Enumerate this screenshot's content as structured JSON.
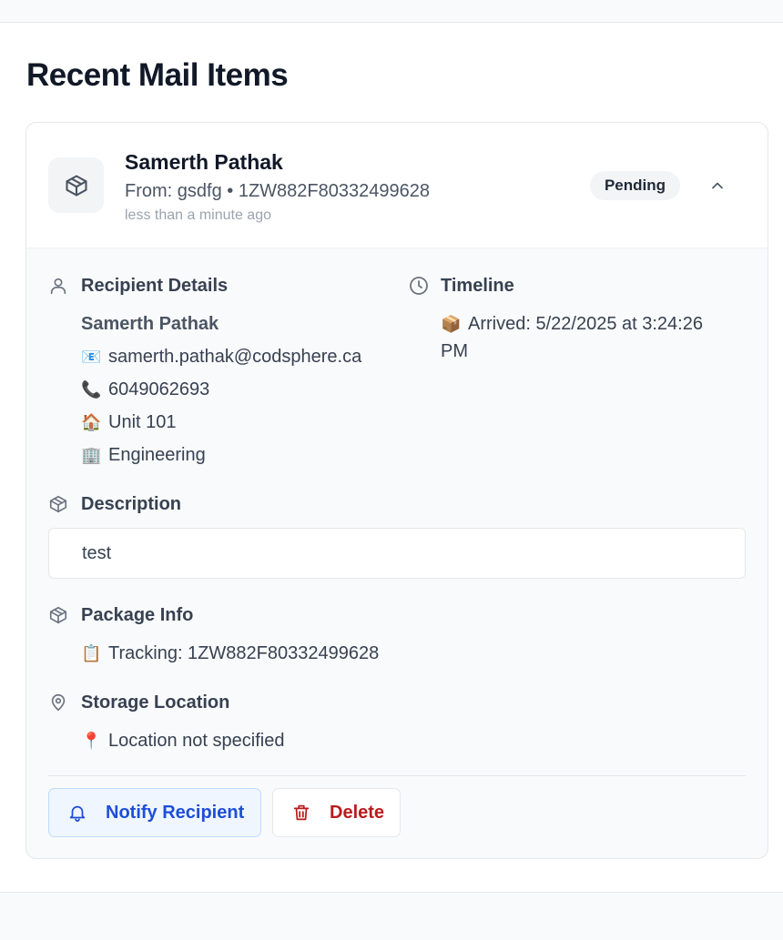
{
  "page": {
    "title": "Recent Mail Items"
  },
  "mail_item": {
    "recipient_name": "Samerth Pathak",
    "from_line": "From: gsdfg • 1ZW882F80332499628",
    "time_ago": "less than a minute ago",
    "status": "Pending",
    "recipient_details": {
      "title": "Recipient Details",
      "name": "Samerth Pathak",
      "email": "samerth.pathak@codsphere.ca",
      "phone": "6049062693",
      "unit": "Unit 101",
      "department": "Engineering",
      "email_emoji": "📧",
      "phone_emoji": "📞",
      "unit_emoji": "🏠",
      "department_emoji": "🏢"
    },
    "timeline": {
      "title": "Timeline",
      "arrived_emoji": "📦",
      "arrived_line1": "Arrived: 5/22/2025 at 3:24:26",
      "arrived_line2": "PM"
    },
    "description": {
      "title": "Description",
      "text": "test"
    },
    "package_info": {
      "title": "Package Info",
      "tracking_emoji": "📋",
      "tracking": "Tracking: 1ZW882F80332499628"
    },
    "storage": {
      "title": "Storage Location",
      "location_emoji": "📍",
      "location": "Location not specified"
    },
    "actions": {
      "notify_label": "Notify Recipient",
      "delete_label": "Delete"
    }
  },
  "icons": {
    "package": "package-icon",
    "chevron": "chevron-up-icon",
    "user": "user-icon",
    "clock": "clock-icon",
    "map_pin": "map-pin-icon",
    "bell": "bell-icon",
    "trash": "trash-icon"
  },
  "colors": {
    "notify_bg": "#eff6ff",
    "notify_text": "#1d4ed8",
    "delete_text": "#b91c1c",
    "status_bg": "#f3f4f6"
  }
}
